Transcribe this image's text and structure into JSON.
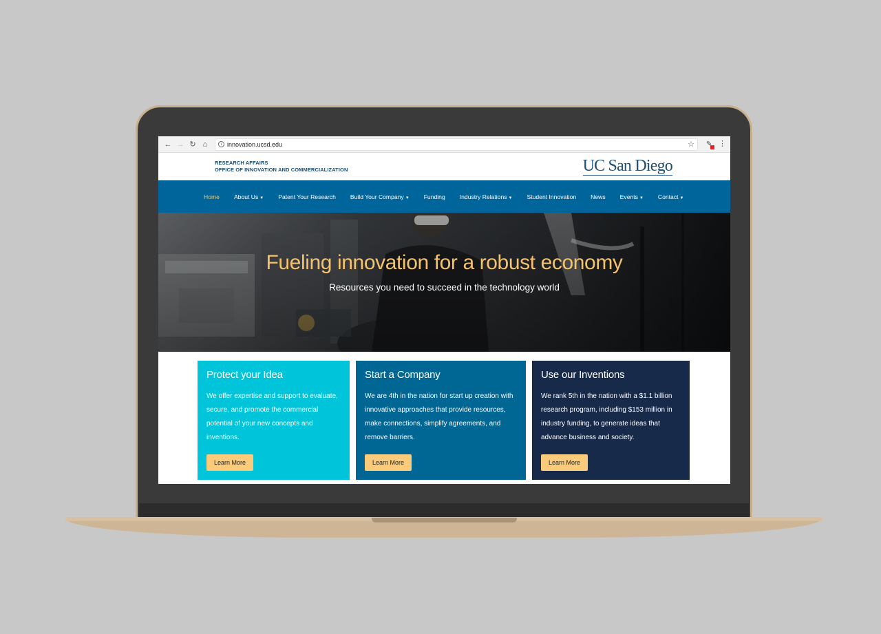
{
  "browser": {
    "url": "innovation.ucsd.edu"
  },
  "header": {
    "dept_line1": "RESEARCH AFFAIRS",
    "dept_line2": "OFFICE OF INNOVATION AND COMMERCIALIZATION",
    "logo": "UC San Diego"
  },
  "nav": {
    "items": [
      {
        "label": "Home",
        "active": true
      },
      {
        "label": "About Us",
        "dropdown": true
      },
      {
        "label": "Patent Your Research"
      },
      {
        "label": "Build Your Company",
        "dropdown": true
      },
      {
        "label": "Funding"
      },
      {
        "label": "Industry Relations",
        "dropdown": true
      },
      {
        "label": "Student Innovation"
      },
      {
        "label": "News"
      },
      {
        "label": "Events",
        "dropdown": true
      },
      {
        "label": "Contact",
        "dropdown": true
      }
    ]
  },
  "hero": {
    "title": "Fueling innovation for a robust economy",
    "subtitle": "Resources you need to succeed in the technology world"
  },
  "cards": [
    {
      "title": "Protect your Idea",
      "body": "We offer expertise and support to evaluate, secure, and promote the commercial potential of your new concepts and inventions.",
      "button": "Learn More"
    },
    {
      "title": "Start a Company",
      "body": "We are 4th in the nation for start up creation with innovative approaches that provide resources, make connections, simplify agreements, and remove barriers.",
      "button": "Learn More"
    },
    {
      "title": "Use our Inventions",
      "body": "We rank 5th in the nation with a $1.1 billion research program, including $153 million in industry funding, to generate ideas that advance business and society.",
      "button": "Learn More"
    }
  ],
  "colors": {
    "nav_bg": "#00659a",
    "accent_gold": "#f5c26e",
    "card1": "#00c4d9",
    "card2": "#006694",
    "card3": "#172a49"
  }
}
